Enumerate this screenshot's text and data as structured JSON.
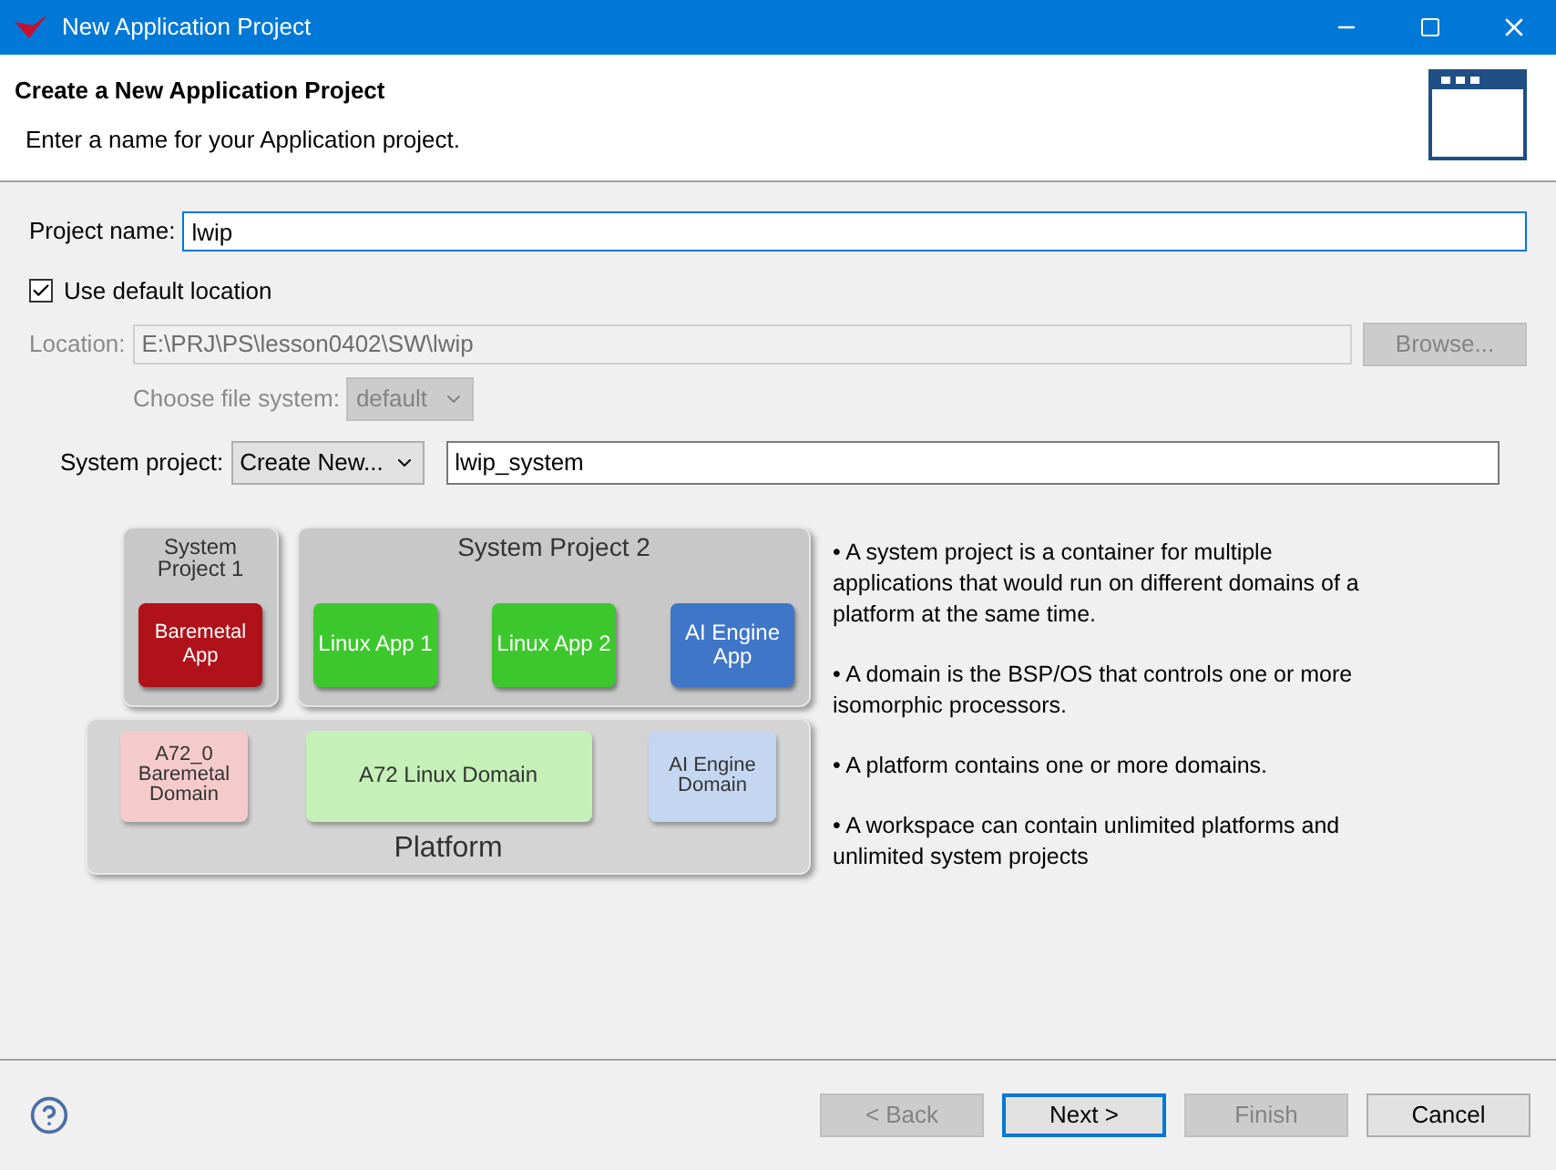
{
  "window": {
    "title": "New Application Project"
  },
  "header": {
    "title": "Create a New Application Project",
    "subtitle": "Enter a name for your Application project."
  },
  "project_name": {
    "label": "Project name:",
    "value": "lwip"
  },
  "use_default_location": {
    "label": "Use default location",
    "checked": true
  },
  "location": {
    "label": "Location:",
    "value": "E:\\PRJ\\PS\\lesson0402\\SW\\lwip",
    "disabled": true,
    "browse": "Browse..."
  },
  "file_system": {
    "label": "Choose file system:",
    "value": "default",
    "disabled": true
  },
  "system_project": {
    "label": "System project:",
    "option": "Create New...",
    "value": "lwip_system"
  },
  "diagram": {
    "system_projects": [
      {
        "title": "System Project 1",
        "apps": [
          {
            "label": "Baremetal App",
            "color": "#b0121a"
          }
        ]
      },
      {
        "title": "System Project 2",
        "apps": [
          {
            "label": "Linux App 1",
            "color": "#3cc82c"
          },
          {
            "label": "Linux App 2",
            "color": "#3cc82c"
          },
          {
            "label": "AI Engine App",
            "color": "#3f76c8"
          }
        ]
      }
    ],
    "platform": {
      "title": "Platform",
      "domains": [
        {
          "label": "A72_0 Baremetal Domain",
          "color": "#f4caca"
        },
        {
          "label": "A72 Linux Domain",
          "color": "#c5f0b8"
        },
        {
          "label": "AI Engine Domain",
          "color": "#c4d6f0"
        }
      ]
    }
  },
  "notes": [
    "• A system project is a container for multiple applications that would run on different domains of a platform at the same time.",
    "• A domain is the BSP/OS that controls one or more isomorphic processors.",
    "• A platform contains one or more domains.",
    "• A workspace can contain unlimited platforms and unlimited system projects"
  ],
  "buttons": [
    {
      "label": "< Back",
      "disabled": true,
      "default": false
    },
    {
      "label": "Next >",
      "disabled": false,
      "default": true
    },
    {
      "label": "Finish",
      "disabled": true,
      "default": false
    },
    {
      "label": "Cancel",
      "disabled": false,
      "default": false
    }
  ]
}
